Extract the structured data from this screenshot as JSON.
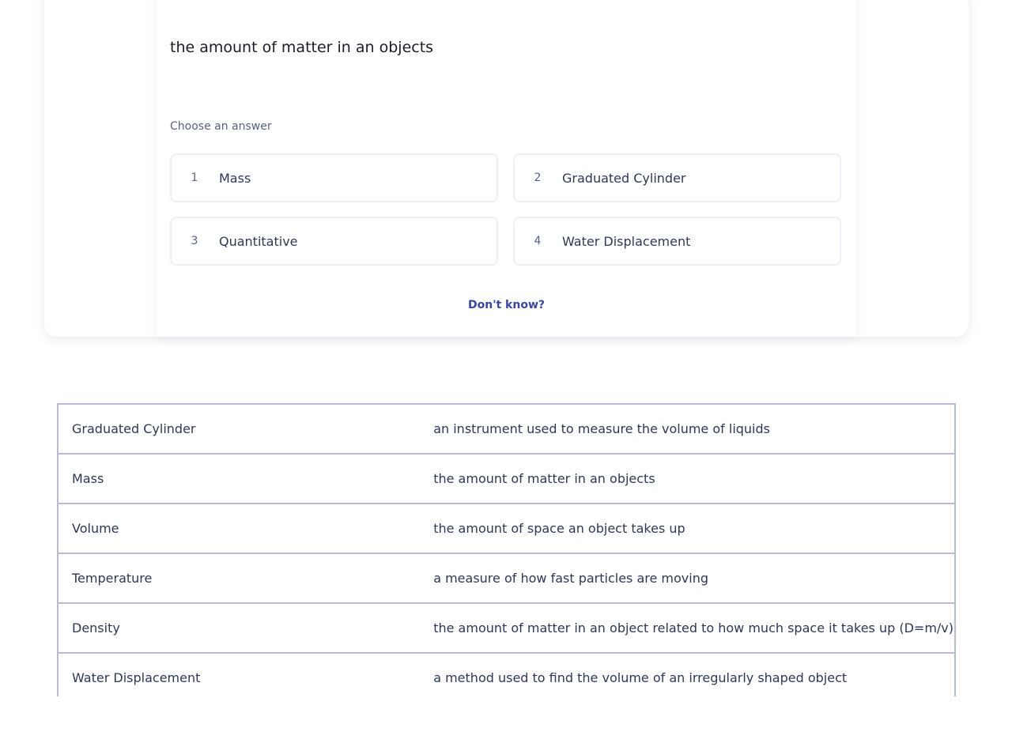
{
  "question": {
    "term": "the amount of matter in an objects",
    "prompt": "Choose an answer",
    "options": [
      {
        "number": "1",
        "label": "Mass"
      },
      {
        "number": "2",
        "label": "Graduated Cylinder"
      },
      {
        "number": "3",
        "label": "Quantitative"
      },
      {
        "number": "4",
        "label": "Water Displacement"
      }
    ],
    "dont_know_label": "Don't know?"
  },
  "terms_table": {
    "rows": [
      {
        "term": "Graduated Cylinder",
        "definition": "an instrument used to measure the volume of liquids"
      },
      {
        "term": "Mass",
        "definition": "the amount of matter in an objects"
      },
      {
        "term": "Volume",
        "definition": "the amount of space an object takes up"
      },
      {
        "term": "Temperature",
        "definition": "a measure of how fast particles are moving"
      },
      {
        "term": "Density",
        "definition": "the amount of matter in an object related to how much space it takes up (D=m/v)"
      },
      {
        "term": "Water Displacement",
        "definition": "a method used to find the volume of an irregularly shaped object"
      }
    ]
  },
  "colors": {
    "accent": "#3a46a0",
    "border": "#b8bbd3",
    "option_border": "#edeff4",
    "text": "#2e3856",
    "muted_text": "#586380"
  }
}
